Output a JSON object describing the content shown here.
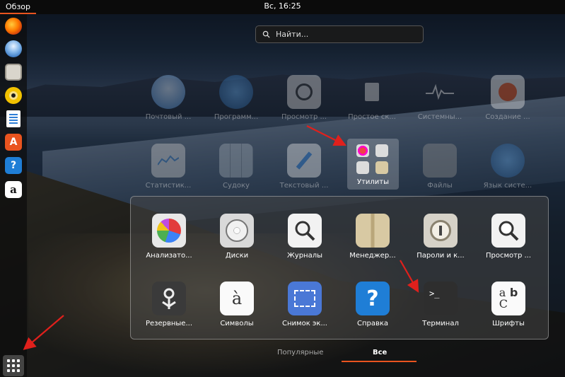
{
  "topbar": {
    "activities_label": "Обзор",
    "clock": "Вс, 16:25"
  },
  "search": {
    "placeholder": "Найти..."
  },
  "dock": {
    "items": [
      {
        "name": "firefox-icon",
        "color": "#e66000"
      },
      {
        "name": "thunderbird-icon",
        "color": "#2f6fbb"
      },
      {
        "name": "files-icon",
        "color": "#c9c4b8"
      },
      {
        "name": "rhythmbox-icon",
        "color": "#f2c200"
      },
      {
        "name": "writer-icon",
        "color": "#2f7fd6"
      },
      {
        "name": "software-icon",
        "color": "#e9541f"
      },
      {
        "name": "help-icon",
        "color": "#1f7ed6"
      },
      {
        "name": "amazon-icon",
        "color": "#ffffff"
      }
    ]
  },
  "grid_top": [
    {
      "label": "Почтовый ...",
      "icon": "mail-icon",
      "color": "#4a8fd0"
    },
    {
      "label": "Программ...",
      "icon": "software-globe-icon",
      "color": "#2c6fb1"
    },
    {
      "label": "Просмотр ...",
      "icon": "magnifier-icon",
      "color": "#d0d0d0"
    },
    {
      "label": "Простое ск...",
      "icon": "scanner-icon",
      "color": "#bdbdbd"
    },
    {
      "label": "Системны...",
      "icon": "system-monitor-icon",
      "color": "#555555"
    },
    {
      "label": "Создание ...",
      "icon": "startup-disk-icon",
      "color": "#e0e0e0"
    },
    {
      "label": "Статистик...",
      "icon": "statistics-icon",
      "color": "#bdbdbd"
    },
    {
      "label": "Судоку",
      "icon": "sudoku-icon",
      "color": "#9aa4ad"
    },
    {
      "label": "Текстовый ...",
      "icon": "text-editor-icon",
      "color": "#e0e0e0"
    },
    {
      "label": "Файлы",
      "icon": "files-folder-icon",
      "color": "#8a8a8a"
    },
    {
      "label": "Язык систе...",
      "icon": "language-globe-icon",
      "color": "#2c6fb1"
    }
  ],
  "utilities_folder": {
    "label": "Утилиты"
  },
  "popover_apps": [
    {
      "label": "Анализато...",
      "icon": "disk-usage-pie-icon"
    },
    {
      "label": "Диски",
      "icon": "disks-icon"
    },
    {
      "label": "Журналы",
      "icon": "logs-icon"
    },
    {
      "label": "Менеджер...",
      "icon": "archive-manager-icon"
    },
    {
      "label": "Пароли и к...",
      "icon": "passwords-keys-icon"
    },
    {
      "label": "Просмотр ...",
      "icon": "document-viewer-icon"
    },
    {
      "label": "Резервные...",
      "icon": "backups-icon"
    },
    {
      "label": "Символы",
      "icon": "characters-icon"
    },
    {
      "label": "Снимок эк...",
      "icon": "screenshot-icon"
    },
    {
      "label": "Справка",
      "icon": "help-icon"
    },
    {
      "label": "Терминал",
      "icon": "terminal-icon"
    },
    {
      "label": "Шрифты",
      "icon": "fonts-icon"
    }
  ],
  "tabs": {
    "popular": "Популярные",
    "all": "Все"
  },
  "colors": {
    "accent": "#e9541f",
    "arrow": "#e0201c"
  }
}
